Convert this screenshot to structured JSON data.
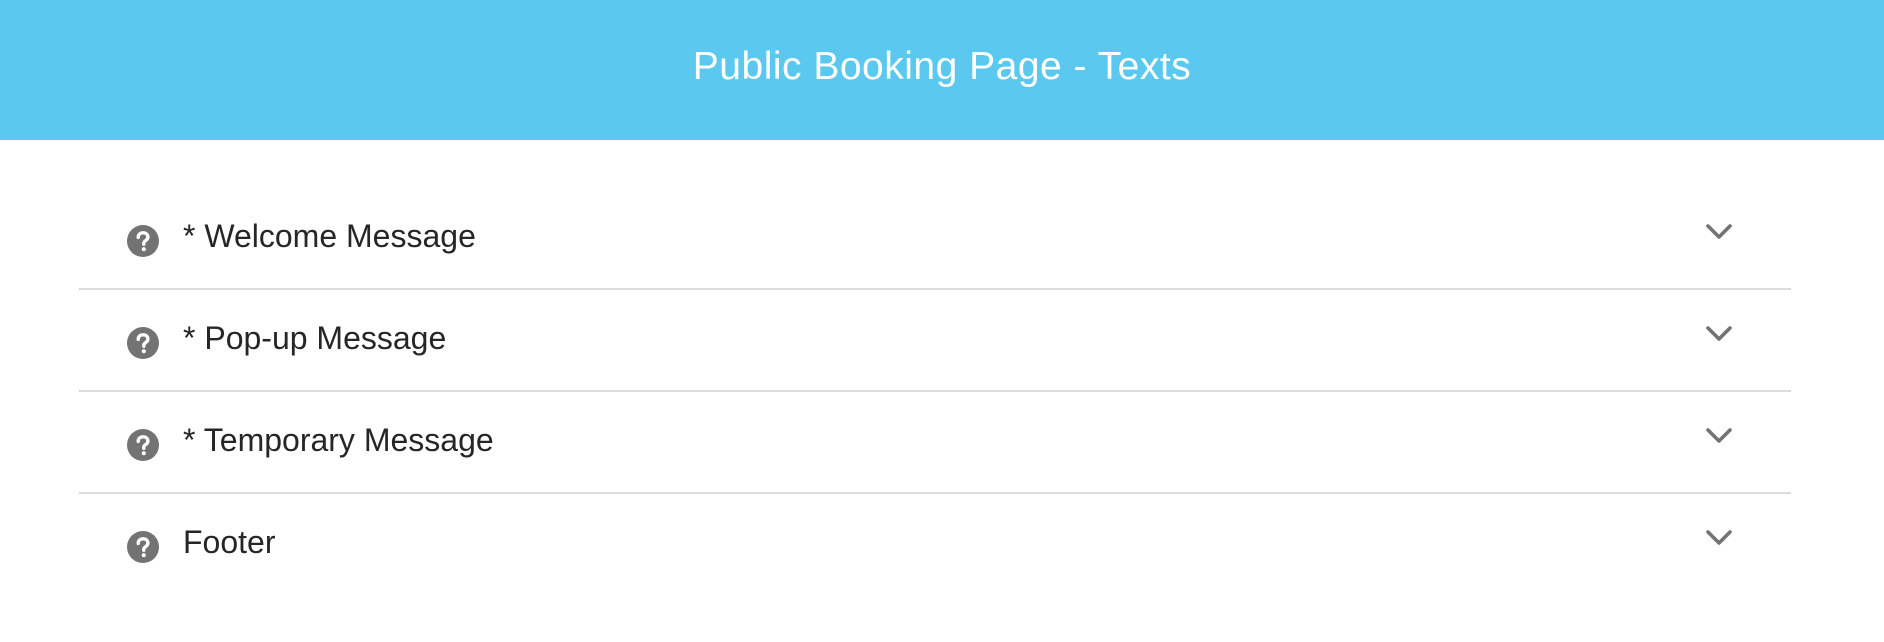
{
  "header": {
    "title": "Public Booking Page - Texts",
    "background": "#5bc9ef"
  },
  "sections": [
    {
      "label": "* Welcome Message",
      "icon": "help-circle-icon",
      "toggle_icon": "chevron-down-icon",
      "expanded": false
    },
    {
      "label": "* Pop-up Message",
      "icon": "help-circle-icon",
      "toggle_icon": "chevron-down-icon",
      "expanded": false
    },
    {
      "label": "* Temporary Message",
      "icon": "help-circle-icon",
      "toggle_icon": "chevron-down-icon",
      "expanded": false
    },
    {
      "label": "Footer",
      "icon": "help-circle-icon",
      "toggle_icon": "chevron-down-icon",
      "expanded": false
    }
  ],
  "colors": {
    "icon": "#737373",
    "text": "#262626",
    "divider": "#dcdcdc"
  }
}
